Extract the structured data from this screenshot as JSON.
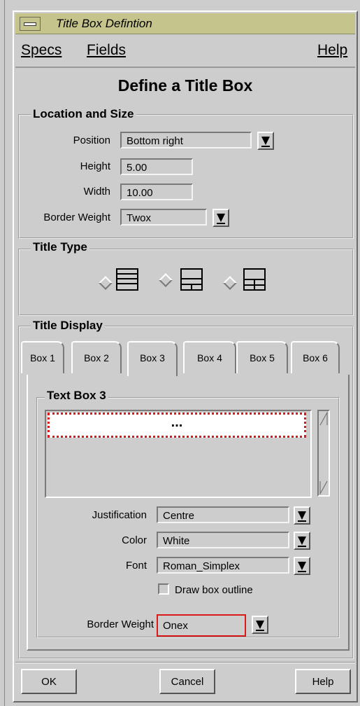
{
  "window": {
    "title": "Title Box Defintion"
  },
  "menubar": {
    "specs": "Specs",
    "fields": "Fields",
    "help": "Help"
  },
  "heading": "Define a Title Box",
  "location_and_size": {
    "label": "Location and Size",
    "position_label": "Position",
    "position_value": "Bottom right",
    "height_label": "Height",
    "height_value": "5.00",
    "width_label": "Width",
    "width_value": "10.00",
    "border_weight_label": "Border Weight",
    "border_weight_value": "Twox"
  },
  "title_type": {
    "label": "Title Type"
  },
  "title_display": {
    "label": "Title Display",
    "tabs": [
      "Box 1",
      "Box 2",
      "Box 3",
      "Box 4",
      "Box 5",
      "Box 6"
    ],
    "active_tab": "Box 3"
  },
  "text_box": {
    "label": "Text Box 3",
    "selected_item": "...",
    "justification_label": "Justification",
    "justification_value": "Centre",
    "color_label": "Color",
    "color_value": "White",
    "font_label": "Font",
    "font_value": "Roman_Simplex",
    "draw_outline_label": "Draw box outline",
    "border_weight_label": "Border Weight",
    "border_weight_value": "Onex"
  },
  "buttons": {
    "ok": "OK",
    "cancel": "Cancel",
    "help": "Help"
  },
  "colors": {
    "titlebar": "#c4c48c",
    "highlight_red": "#d81a1a"
  }
}
